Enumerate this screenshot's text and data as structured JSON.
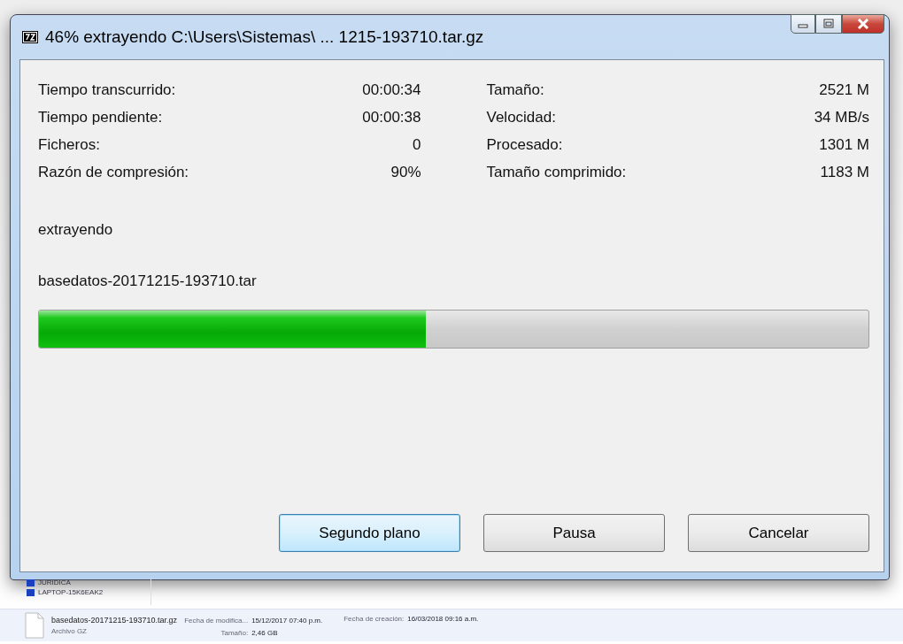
{
  "window": {
    "title": "46% extrayendo C:\\Users\\Sistemas\\ ... 1215-193710.tar.gz"
  },
  "stats_left": [
    {
      "label": "Tiempo transcurrido:",
      "value": "00:00:34"
    },
    {
      "label": "Tiempo pendiente:",
      "value": "00:00:38"
    },
    {
      "label": "Ficheros:",
      "value": "0"
    },
    {
      "label": "Razón de compresión:",
      "value": "90%"
    }
  ],
  "stats_right": [
    {
      "label": "Tamaño:",
      "value": "2521 M"
    },
    {
      "label": "Velocidad:",
      "value": "34 MB/s"
    },
    {
      "label": "Procesado:",
      "value": "1301 M"
    },
    {
      "label": "Tamaño comprimido:",
      "value": "1183 M"
    }
  ],
  "operation": "extrayendo",
  "current_file": "basedatos-20171215-193710.tar",
  "progress": {
    "level": 0.466
  },
  "buttons": [
    {
      "label": "Segundo plano",
      "focused": true
    },
    {
      "label": "Pausa",
      "focused": false
    },
    {
      "label": "Cancelar",
      "focused": false
    }
  ],
  "explorer": {
    "nav_items": [
      "JURIDICA",
      "LAPTOP-15K6EAK2"
    ],
    "details": {
      "file_name": "basedatos-20171215-193710.tar.gz",
      "file_type": "Archivo GZ",
      "modified_label": "Fecha de modifica...",
      "modified_value": "15/12/2017 07:40 p.m.",
      "created_label": "Fecha de creación:",
      "created_value": "16/03/2018 09:16 a.m.",
      "size_label": "Tamaño:",
      "size_value": "2,46 GB"
    }
  }
}
